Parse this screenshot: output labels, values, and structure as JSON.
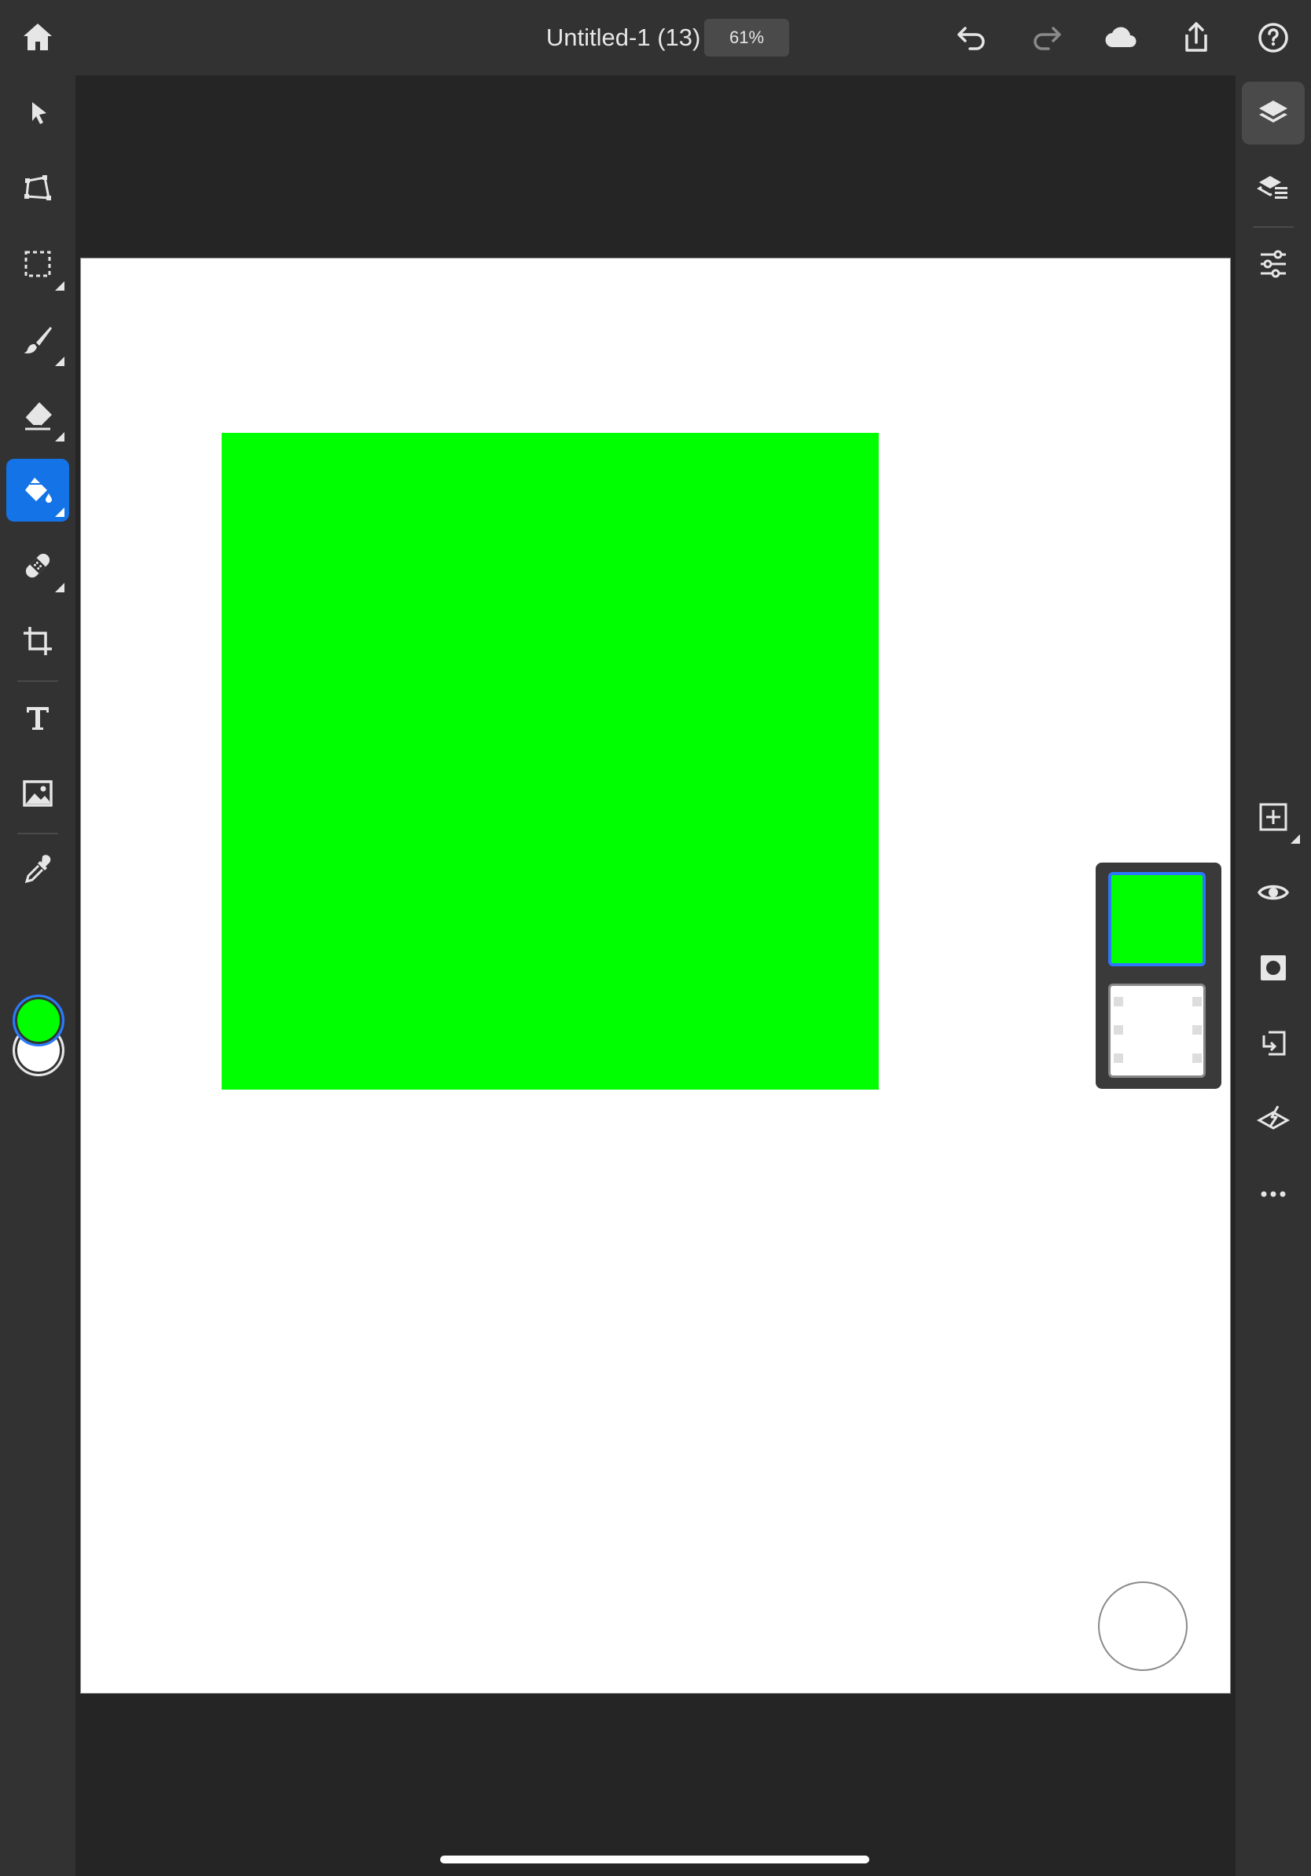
{
  "document": {
    "title": "Untitled-1 (13) *",
    "zoom": "61%"
  },
  "colors": {
    "accent": "#1473e6",
    "foreground_color": "#00ff00",
    "background_color": "#ffffff",
    "shape_fill": "#00ff00"
  },
  "topbar": {
    "home_icon": "home-icon",
    "undo_icon": "undo-icon",
    "redo_icon": "redo-icon",
    "cloud_icon": "cloud-icon",
    "share_icon": "share-icon",
    "help_icon": "help-icon"
  },
  "left_tools": [
    "move-tool-icon",
    "transform-tool-icon",
    "selection-tool-icon",
    "brush-tool-icon",
    "eraser-tool-icon",
    "paint-bucket-tool-icon",
    "healing-tool-icon",
    "crop-tool-icon",
    "type-tool-icon",
    "image-tool-icon",
    "eyedropper-tool-icon"
  ],
  "active_tool": "paint-bucket-tool-icon",
  "right_tools": [
    "layers-icon",
    "layer-properties-icon",
    "adjustments-icon",
    "add-layer-icon",
    "visibility-icon",
    "mask-icon",
    "clip-layer-icon",
    "fill-layer-icon",
    "more-icon"
  ],
  "layers": [
    {
      "type": "fill",
      "color": "#00ff00",
      "selected": true
    },
    {
      "type": "background",
      "color": "#ffffff",
      "selected": false
    }
  ]
}
